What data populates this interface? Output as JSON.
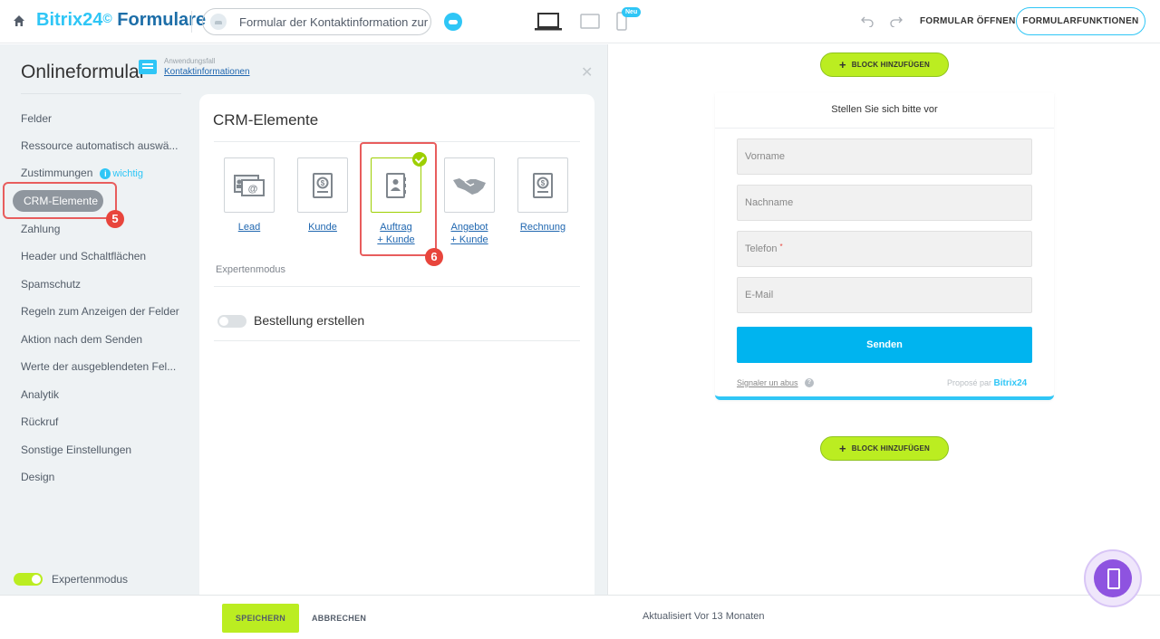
{
  "header": {
    "brand_bitrix": "Bitrix24",
    "brand_mark": "©",
    "brand_product": "Formulare",
    "form_name": "Formular der Kontaktinformation zur N...",
    "new_badge": "Neu",
    "open_form_label": "FORMULAR ÖFFNEN",
    "form_functions_label": "FORMULARFUNKTIONEN"
  },
  "sidebar": {
    "title": "Onlineformular",
    "usecase_label": "Anwendungsfall",
    "usecase_value": "Kontaktinformationen",
    "items": [
      {
        "label": "Felder"
      },
      {
        "label": "Ressource automatisch auswä..."
      },
      {
        "label": "Zustimmungen",
        "tag": "wichtig"
      },
      {
        "label": "CRM-Elemente",
        "active": true
      },
      {
        "label": "Zahlung"
      },
      {
        "label": "Header und Schaltflächen"
      },
      {
        "label": "Spamschutz"
      },
      {
        "label": "Regeln zum Anzeigen der Felder"
      },
      {
        "label": "Aktion nach dem Senden"
      },
      {
        "label": "Werte der ausgeblendeten Fel..."
      },
      {
        "label": "Analytik"
      },
      {
        "label": "Rückruf"
      },
      {
        "label": "Sonstige Einstellungen"
      },
      {
        "label": "Design"
      }
    ],
    "expert_mode_label": "Expertenmodus",
    "expert_mode_on": true
  },
  "annotations": {
    "step_5": "5",
    "step_6": "6",
    "highlight_color": "#e85d5d"
  },
  "crm": {
    "title": "CRM-Elemente",
    "tiles": [
      {
        "label_line1": "Lead",
        "label_line2": "",
        "icon": "lead-card-icon"
      },
      {
        "label_line1": "Kunde",
        "label_line2": "",
        "icon": "customer-doc-icon"
      },
      {
        "label_line1": "Auftrag",
        "label_line2": "+ Kunde",
        "icon": "contact-book-icon",
        "selected": true
      },
      {
        "label_line1": "Angebot",
        "label_line2": "+ Kunde",
        "icon": "handshake-icon"
      },
      {
        "label_line1": "Rechnung",
        "label_line2": "",
        "icon": "invoice-icon"
      }
    ],
    "expert_mode_caption": "Expertenmodus",
    "create_order_label": "Bestellung erstellen",
    "create_order_on": false
  },
  "preview": {
    "add_block_label": "BLOCK HINZUFÜGEN",
    "form_title": "Stellen Sie sich bitte vor",
    "fields": [
      {
        "placeholder": "Vorname",
        "required": false
      },
      {
        "placeholder": "Nachname",
        "required": false
      },
      {
        "placeholder": "Telefon",
        "required": true
      },
      {
        "placeholder": "E-Mail",
        "required": false
      }
    ],
    "required_marker": "*",
    "submit_label": "Senden",
    "report_abuse": "Signaler un abus",
    "help_glyph": "?",
    "powered_by": "Proposé par",
    "powered_brand": "Bitrix24"
  },
  "footer": {
    "save_label": "SPEICHERN",
    "cancel_label": "ABBRECHEN",
    "updated_label": "Aktualisiert Vor 13 Monaten"
  },
  "colors": {
    "accent": "#2fc6f6",
    "brand_dark": "#1d6ea8",
    "lime": "#bbed21",
    "submit_blue": "#00b4ef",
    "purple": "#8e53e0"
  }
}
